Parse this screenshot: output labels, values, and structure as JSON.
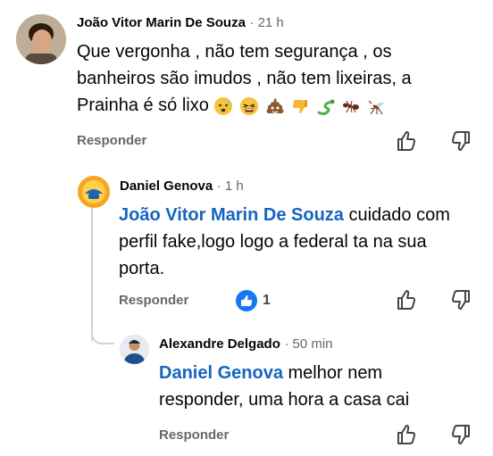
{
  "comments": [
    {
      "author": "João Vitor Marin De Souza",
      "time": "21 h",
      "text": "Que vergonha , não tem segurança , os banheiros são imudos , não tem lixeiras,  a Prainha é só lixo",
      "reply_label": "Responder"
    },
    {
      "author": "Daniel Genova",
      "time": "1 h",
      "mention": "João Vitor Marin De Souza",
      "text": "cuidado com perfil fake,logo logo a federal ta na sua porta.",
      "reply_label": "Responder",
      "like_count": "1"
    },
    {
      "author": "Alexandre Delgado",
      "time": "50 min",
      "mention": "Daniel Genova",
      "text": "melhor nem responder, uma hora a casa cai",
      "reply_label": "Responder"
    }
  ],
  "emojis": [
    "anxious-face-icon",
    "tired-face-icon",
    "poop-icon",
    "thumbs-down-icon",
    "snake-icon",
    "ant-icon",
    "mosquito-icon"
  ],
  "colors": {
    "mention": "#1565c0",
    "meta": "#65676b",
    "like_blue": "#1877f2"
  }
}
